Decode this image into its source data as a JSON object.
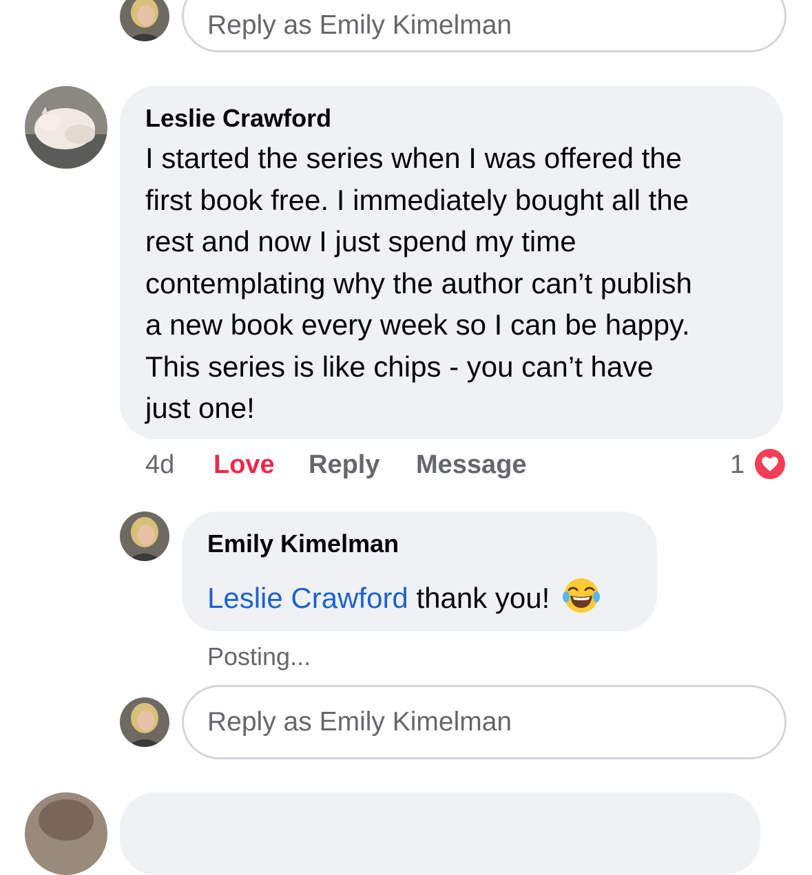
{
  "reply_box_top": {
    "placeholder": "Reply as Emily Kimelman"
  },
  "comment": {
    "author": "Leslie Crawford",
    "lines": [
      "I started the series when I was offered the",
      "first book free. I immediately bought all the",
      "rest and now I just spend my time",
      "contemplating why the author can’t publish",
      "a new book every week so I can be happy.",
      "This series is like chips - you can’t have",
      "just one!"
    ],
    "timestamp": "4d",
    "actions": {
      "love": "Love",
      "reply": "Reply",
      "message": "Message"
    },
    "reaction_count": "1",
    "reaction_icon": "heart-icon"
  },
  "reply": {
    "author": "Emily Kimelman",
    "mention": "Leslie Crawford",
    "text": "thank you!",
    "emoji": "face-with-tears-of-joy-icon",
    "status": "Posting..."
  },
  "reply_box_bottom": {
    "placeholder": "Reply as Emily Kimelman"
  },
  "colors": {
    "bubble": "#f0f1f5",
    "love": "#f0284a",
    "mention": "#1b63cf",
    "muted": "#65676b"
  }
}
